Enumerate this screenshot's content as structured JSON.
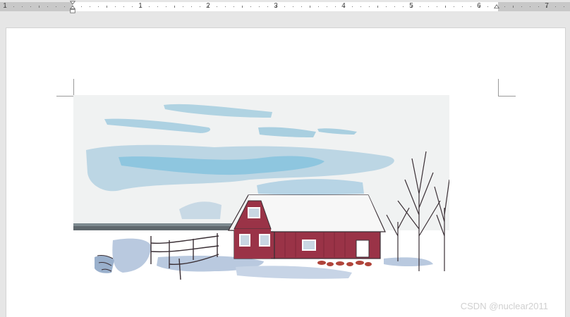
{
  "ruler": {
    "numbers": [
      "1",
      "1",
      "2",
      "3",
      "4",
      "5",
      "6",
      "7"
    ]
  },
  "document": {
    "image_description_icon": "winter-barn-illustration"
  },
  "watermark": {
    "text": "CSDN @nuclear2011"
  },
  "colors": {
    "barn": "#9a3347",
    "roof": "#f2f2f2",
    "sky": "#f0f2f2",
    "clouds": "#a9cfe0",
    "snow_shadow": "#b9c9df",
    "sketch": "#3a2f35"
  }
}
